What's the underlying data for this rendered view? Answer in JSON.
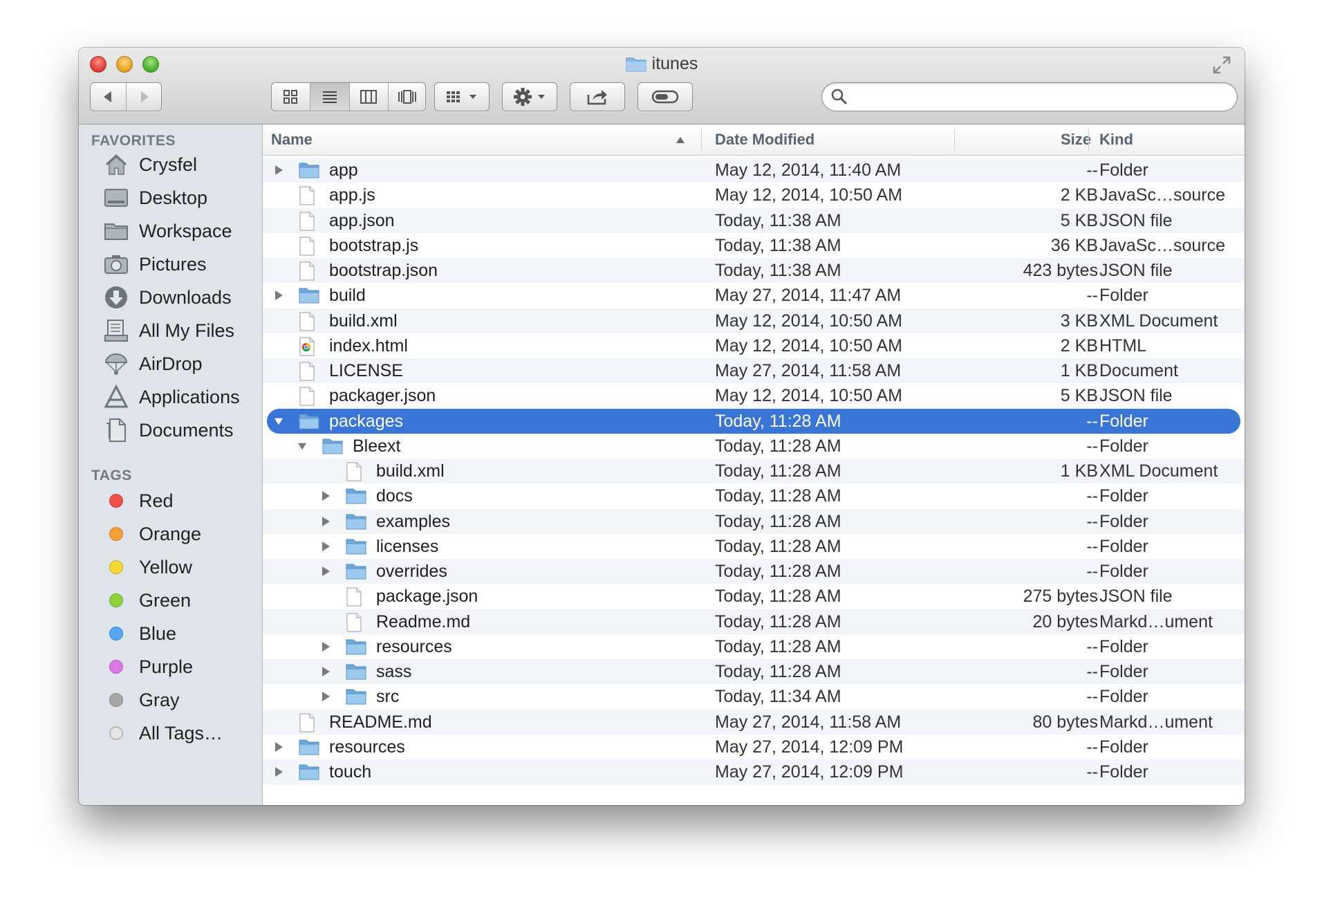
{
  "window": {
    "title": "itunes"
  },
  "toolbar": {
    "back_icon": "back-arrow-icon",
    "forward_icon": "forward-arrow-icon",
    "views": [
      "icon-view-icon",
      "list-view-icon",
      "column-view-icon",
      "coverflow-view-icon"
    ],
    "active_view": "list",
    "arrange_icon": "arrange-grid-icon",
    "action_icon": "gear-icon",
    "share_icon": "share-icon",
    "tag_icon": "tag-pill-icon",
    "search_placeholder": ""
  },
  "sidebar": {
    "favorites_header": "FAVORITES",
    "favorites": [
      {
        "label": "Crysfel",
        "icon": "home-icon"
      },
      {
        "label": "Desktop",
        "icon": "desktop-icon"
      },
      {
        "label": "Workspace",
        "icon": "folder-icon"
      },
      {
        "label": "Pictures",
        "icon": "camera-icon"
      },
      {
        "label": "Downloads",
        "icon": "downloads-icon"
      },
      {
        "label": "All My Files",
        "icon": "all-files-icon"
      },
      {
        "label": "AirDrop",
        "icon": "airdrop-icon"
      },
      {
        "label": "Applications",
        "icon": "applications-icon"
      },
      {
        "label": "Documents",
        "icon": "documents-icon"
      }
    ],
    "tags_header": "TAGS",
    "tags": [
      {
        "label": "Red",
        "color": "#f0504a"
      },
      {
        "label": "Orange",
        "color": "#f6a136"
      },
      {
        "label": "Yellow",
        "color": "#f4d830"
      },
      {
        "label": "Green",
        "color": "#8ed13b"
      },
      {
        "label": "Blue",
        "color": "#55a7f2"
      },
      {
        "label": "Purple",
        "color": "#d97ae6"
      },
      {
        "label": "Gray",
        "color": "#a7a7a7"
      },
      {
        "label": "All Tags…",
        "color": "#e6e6e6"
      }
    ]
  },
  "columns": {
    "name": "Name",
    "date": "Date Modified",
    "size": "Size",
    "kind": "Kind",
    "sort": "ascending"
  },
  "rows": [
    {
      "name": "app",
      "date": "May 12, 2014, 11:40 AM",
      "size": "--",
      "kind": "Folder",
      "type": "folder",
      "level": 0,
      "disclosure": "closed"
    },
    {
      "name": "app.js",
      "date": "May 12, 2014, 10:50 AM",
      "size": "2 KB",
      "kind": "JavaSc…source",
      "type": "file",
      "level": 0,
      "disclosure": "none"
    },
    {
      "name": "app.json",
      "date": "Today, 11:38 AM",
      "size": "5 KB",
      "kind": "JSON file",
      "type": "file",
      "level": 0,
      "disclosure": "none"
    },
    {
      "name": "bootstrap.js",
      "date": "Today, 11:38 AM",
      "size": "36 KB",
      "kind": "JavaSc…source",
      "type": "file",
      "level": 0,
      "disclosure": "none"
    },
    {
      "name": "bootstrap.json",
      "date": "Today, 11:38 AM",
      "size": "423 bytes",
      "kind": "JSON file",
      "type": "file",
      "level": 0,
      "disclosure": "none"
    },
    {
      "name": "build",
      "date": "May 27, 2014, 11:47 AM",
      "size": "--",
      "kind": "Folder",
      "type": "folder",
      "level": 0,
      "disclosure": "closed"
    },
    {
      "name": "build.xml",
      "date": "May 12, 2014, 10:50 AM",
      "size": "3 KB",
      "kind": "XML Document",
      "type": "file",
      "level": 0,
      "disclosure": "none"
    },
    {
      "name": "index.html",
      "date": "May 12, 2014, 10:50 AM",
      "size": "2 KB",
      "kind": "HTML",
      "type": "html",
      "level": 0,
      "disclosure": "none"
    },
    {
      "name": "LICENSE",
      "date": "May 27, 2014, 11:58 AM",
      "size": "1 KB",
      "kind": "Document",
      "type": "file",
      "level": 0,
      "disclosure": "none"
    },
    {
      "name": "packager.json",
      "date": "May 12, 2014, 10:50 AM",
      "size": "5 KB",
      "kind": "JSON file",
      "type": "file",
      "level": 0,
      "disclosure": "none"
    },
    {
      "name": "packages",
      "date": "Today, 11:28 AM",
      "size": "--",
      "kind": "Folder",
      "type": "folder",
      "level": 0,
      "disclosure": "open",
      "selected": true
    },
    {
      "name": "Bleext",
      "date": "Today, 11:28 AM",
      "size": "--",
      "kind": "Folder",
      "type": "folder",
      "level": 1,
      "disclosure": "open"
    },
    {
      "name": "build.xml",
      "date": "Today, 11:28 AM",
      "size": "1 KB",
      "kind": "XML Document",
      "type": "file",
      "level": 2,
      "disclosure": "none"
    },
    {
      "name": "docs",
      "date": "Today, 11:28 AM",
      "size": "--",
      "kind": "Folder",
      "type": "folder",
      "level": 2,
      "disclosure": "closed"
    },
    {
      "name": "examples",
      "date": "Today, 11:28 AM",
      "size": "--",
      "kind": "Folder",
      "type": "folder",
      "level": 2,
      "disclosure": "closed"
    },
    {
      "name": "licenses",
      "date": "Today, 11:28 AM",
      "size": "--",
      "kind": "Folder",
      "type": "folder",
      "level": 2,
      "disclosure": "closed"
    },
    {
      "name": "overrides",
      "date": "Today, 11:28 AM",
      "size": "--",
      "kind": "Folder",
      "type": "folder",
      "level": 2,
      "disclosure": "closed"
    },
    {
      "name": "package.json",
      "date": "Today, 11:28 AM",
      "size": "275 bytes",
      "kind": "JSON file",
      "type": "file",
      "level": 2,
      "disclosure": "none"
    },
    {
      "name": "Readme.md",
      "date": "Today, 11:28 AM",
      "size": "20 bytes",
      "kind": "Markd…ument",
      "type": "file",
      "level": 2,
      "disclosure": "none"
    },
    {
      "name": "resources",
      "date": "Today, 11:28 AM",
      "size": "--",
      "kind": "Folder",
      "type": "folder",
      "level": 2,
      "disclosure": "closed"
    },
    {
      "name": "sass",
      "date": "Today, 11:28 AM",
      "size": "--",
      "kind": "Folder",
      "type": "folder",
      "level": 2,
      "disclosure": "closed"
    },
    {
      "name": "src",
      "date": "Today, 11:34 AM",
      "size": "--",
      "kind": "Folder",
      "type": "folder",
      "level": 2,
      "disclosure": "closed"
    },
    {
      "name": "README.md",
      "date": "May 27, 2014, 11:58 AM",
      "size": "80 bytes",
      "kind": "Markd…ument",
      "type": "file",
      "level": 0,
      "disclosure": "none"
    },
    {
      "name": "resources",
      "date": "May 27, 2014, 12:09 PM",
      "size": "--",
      "kind": "Folder",
      "type": "folder",
      "level": 0,
      "disclosure": "closed"
    },
    {
      "name": "touch",
      "date": "May 27, 2014, 12:09 PM",
      "size": "--",
      "kind": "Folder",
      "type": "folder",
      "level": 0,
      "disclosure": "closed"
    }
  ],
  "colors": {
    "selection": "#3875d7",
    "folder": "#7fb3df",
    "stripe": "#f1f5fa",
    "sidebar": "#dfe4ea"
  }
}
